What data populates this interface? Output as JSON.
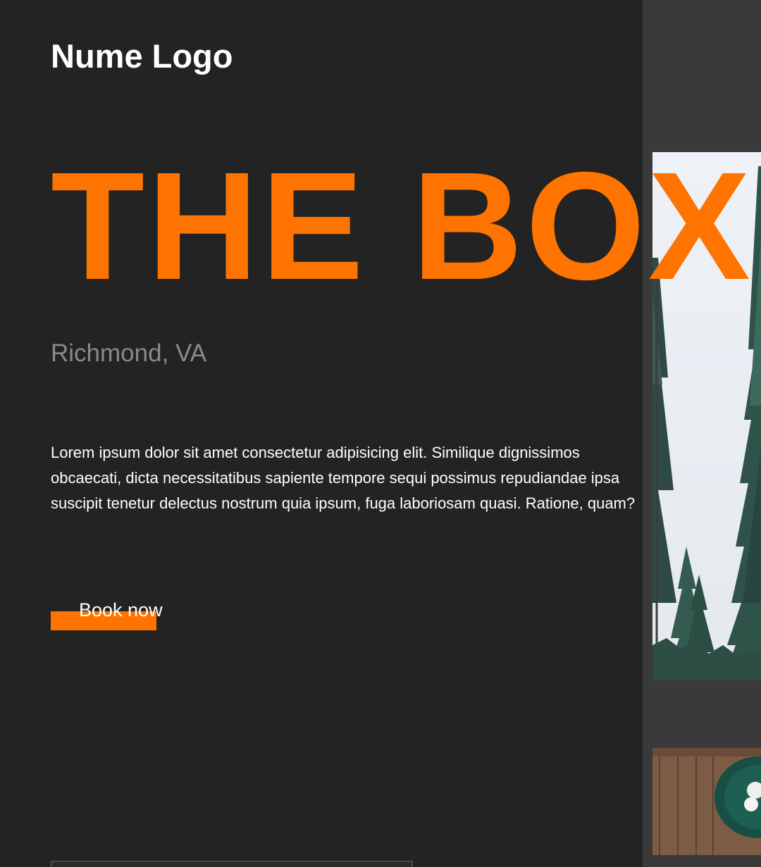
{
  "brand": {
    "logo_text": "Nume Logo"
  },
  "hero": {
    "title": "THE BOX",
    "location": "Richmond, VA",
    "description": "Lorem ipsum dolor sit amet consectetur adipisicing elit. Similique dignissimos obcaecati, dicta necessitatibus sapiente tempore sequi possimus repudiandae ipsa suscipit tenetur delectus nostrum quia ipsum, fuga laboriosam quasi. Ratione, quam?",
    "cta_label": "Book now"
  },
  "colors": {
    "background": "#232323",
    "side_panel": "#3a3a3a",
    "accent": "#ff7400",
    "muted_text": "#8a8a8a"
  }
}
